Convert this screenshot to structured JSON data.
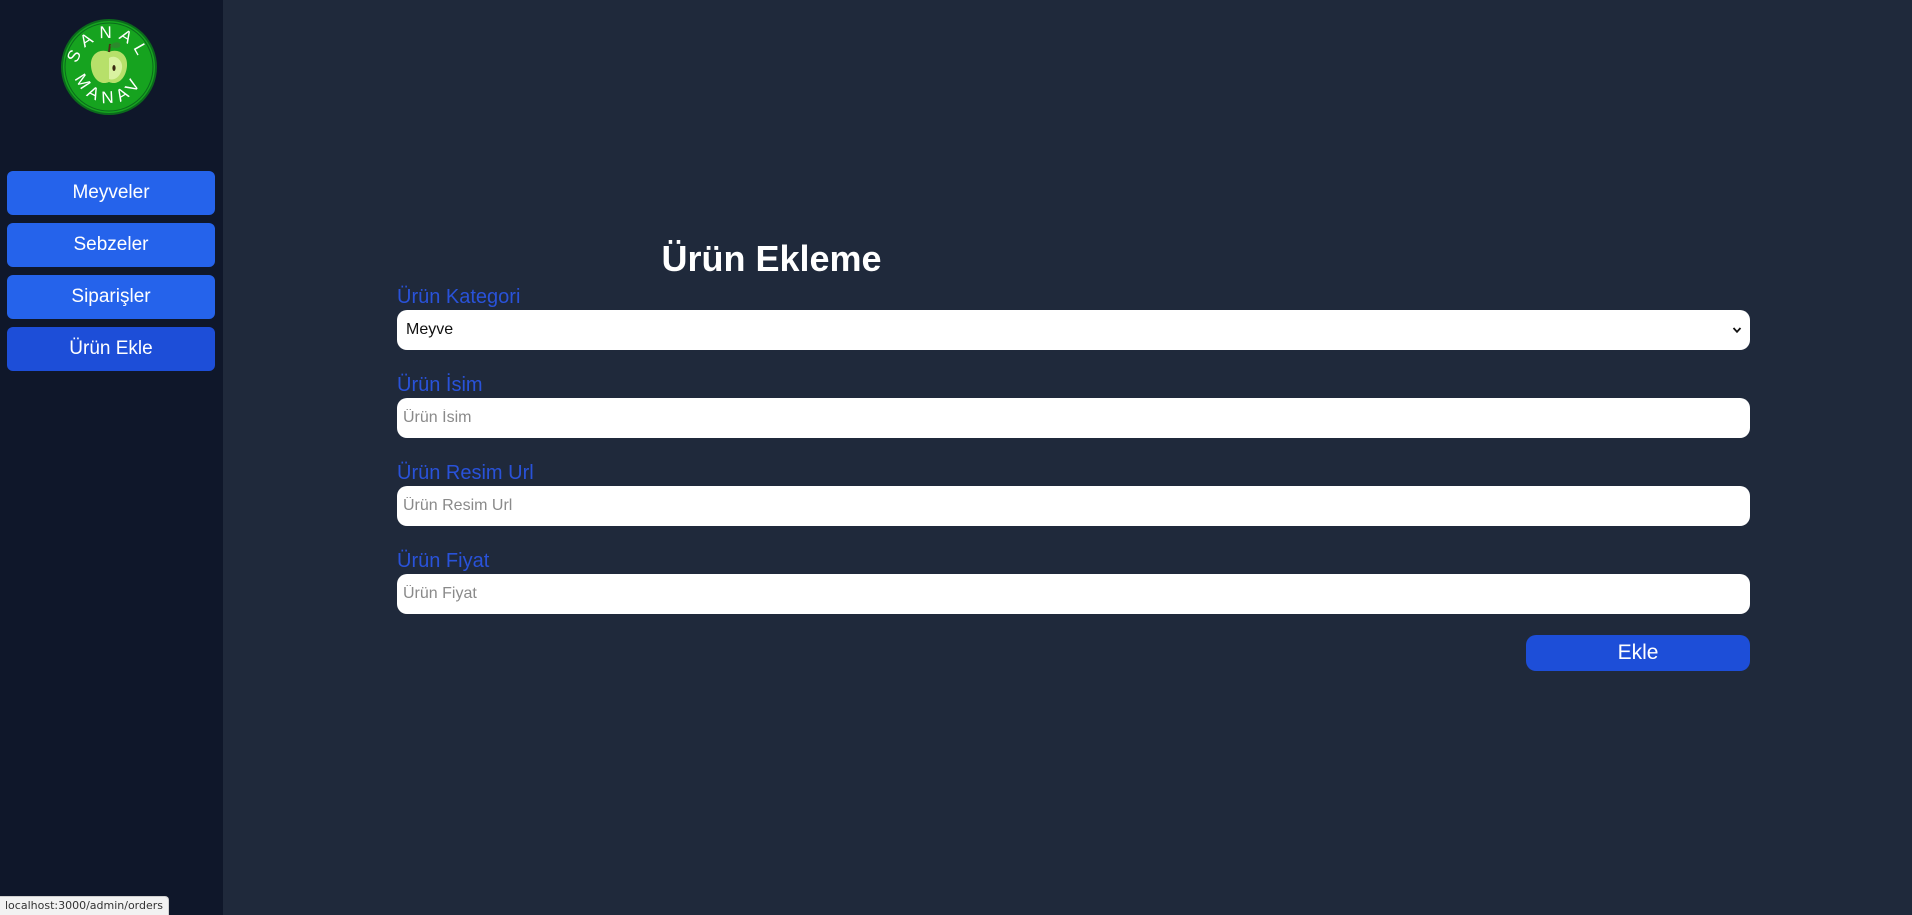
{
  "logo": {
    "text_top": "SANAL",
    "text_bottom": "MANAV",
    "icon": "apple-logo"
  },
  "sidebar": {
    "items": [
      {
        "label": "Meyveler",
        "icon": "none"
      },
      {
        "label": "Sebzeler",
        "icon": "none"
      },
      {
        "label": "Siparişler",
        "icon": "none"
      },
      {
        "label": "Ürün Ekle",
        "icon": "none"
      }
    ]
  },
  "page": {
    "title": "Ürün Ekleme"
  },
  "form": {
    "category": {
      "label": "Ürün Kategori",
      "value": "Meyve"
    },
    "name": {
      "label": "Ürün İsim",
      "placeholder": "Ürün İsim"
    },
    "image_url": {
      "label": "Ürün Resim Url",
      "placeholder": "Ürün Resim Url"
    },
    "price": {
      "label": "Ürün Fiyat",
      "placeholder": "Ürün Fiyat"
    },
    "submit_label": "Ekle"
  },
  "status_bar": {
    "url": "localhost:3000/admin/orders"
  },
  "colors": {
    "sidebar_bg": "#0f172a",
    "main_bg": "#1f293b",
    "button_blue": "#2563eb",
    "label_blue": "#2952d9",
    "logo_green": "#16a34a"
  }
}
